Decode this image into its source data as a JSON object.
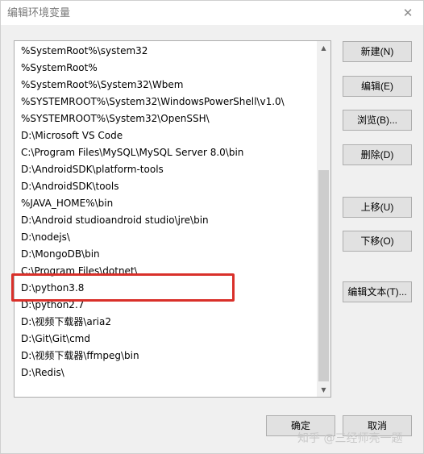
{
  "window": {
    "title": "编辑环境变量",
    "close_glyph": "✕"
  },
  "paths": [
    "%SystemRoot%\\system32",
    "%SystemRoot%",
    "%SystemRoot%\\System32\\Wbem",
    "%SYSTEMROOT%\\System32\\WindowsPowerShell\\v1.0\\",
    "%SYSTEMROOT%\\System32\\OpenSSH\\",
    "D:\\Microsoft VS Code",
    "C:\\Program Files\\MySQL\\MySQL Server 8.0\\bin",
    "D:\\AndroidSDK\\platform-tools",
    "D:\\AndroidSDK\\tools",
    "%JAVA_HOME%\\bin",
    "D:\\Android studioandroid studio\\jre\\bin",
    "D:\\nodejs\\",
    "D:\\MongoDB\\bin",
    "C:\\Program Files\\dotnet\\",
    "D:\\python3.8",
    "D:\\python2.7",
    "D:\\视频下载器\\aria2",
    "D:\\Git\\Git\\cmd",
    "D:\\视频下载器\\ffmpeg\\bin",
    "D:\\Redis\\"
  ],
  "highlighted_path": "D:\\python3.8",
  "buttons": {
    "new": "新建(N)",
    "edit": "编辑(E)",
    "browse": "浏览(B)...",
    "delete": "删除(D)",
    "move_up": "上移(U)",
    "move_down": "下移(O)",
    "edit_text": "编辑文本(T)...",
    "ok": "确定",
    "cancel": "取消"
  },
  "scrollbar": {
    "up_glyph": "▲",
    "down_glyph": "▼"
  },
  "watermark": "知乎 @三经师亮一题",
  "colors": {
    "highlight_border": "#d9302a"
  }
}
